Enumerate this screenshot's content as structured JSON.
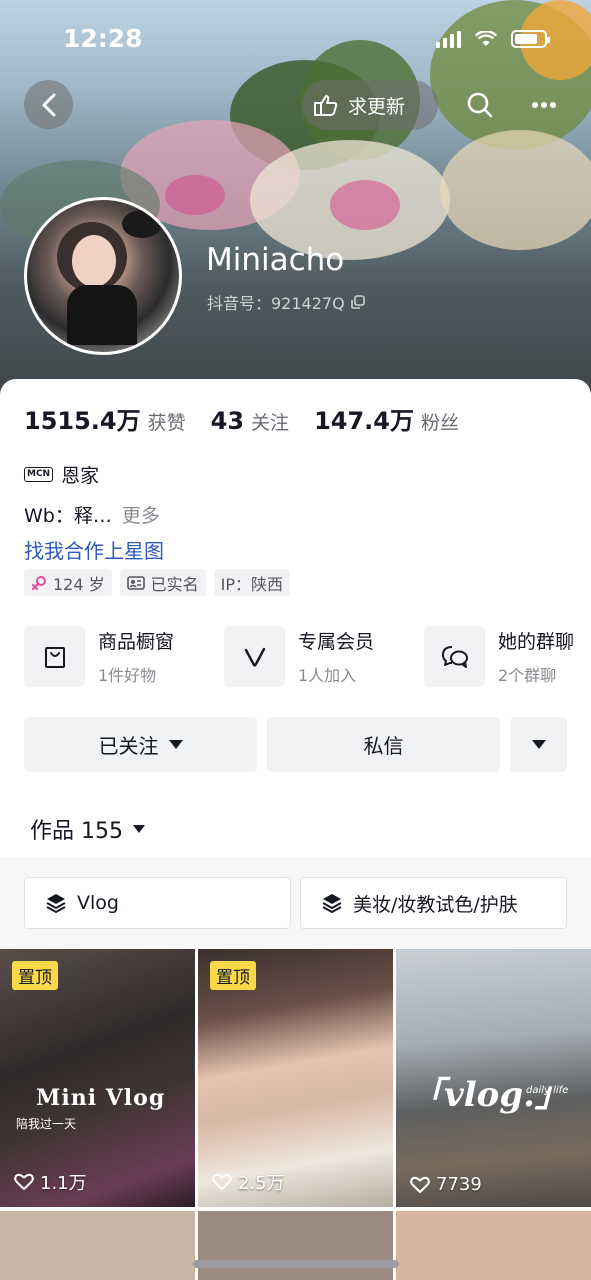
{
  "status_bar": {
    "time": "12:28"
  },
  "header": {
    "update_label": "求更新",
    "name": "Miniacho",
    "douyin_id": "抖音号：921427Q"
  },
  "stats": [
    {
      "value": "1515.4万",
      "label": "获赞"
    },
    {
      "value": "43",
      "label": "关注"
    },
    {
      "value": "147.4万",
      "label": "粉丝"
    }
  ],
  "mcn": {
    "badge": "MCN",
    "name": "恩家"
  },
  "bio": {
    "text": "Wb：释…",
    "more": "更多"
  },
  "star_link": "找我合作上星图",
  "tags": [
    {
      "icon": "female-icon",
      "text": "124 岁"
    },
    {
      "icon": "id-card-icon",
      "text": "已实名"
    },
    {
      "icon": "",
      "text": "IP：陕西"
    }
  ],
  "features": [
    {
      "icon": "shopping-bag-icon",
      "title": "商品橱窗",
      "sub": "1件好物"
    },
    {
      "icon": "member-v-icon",
      "title": "专属会员",
      "sub": "1人加入"
    },
    {
      "icon": "chat-bubbles-icon",
      "title": "她的群聊",
      "sub": "2个群聊"
    }
  ],
  "actions": {
    "followed": "已关注",
    "message": "私信"
  },
  "works": {
    "label": "作品 155"
  },
  "collections": [
    {
      "icon": "layers-icon",
      "label": "Vlog"
    },
    {
      "icon": "layers-icon",
      "label": "美妆/妆教试色/护肤"
    }
  ],
  "videos": [
    {
      "pinned": "置顶",
      "likes": "1.1万",
      "overlay_title": "Mini Vlog",
      "overlay_sub": "陪我过一天"
    },
    {
      "pinned": "置顶",
      "likes": "2.5万"
    },
    {
      "likes": "7739",
      "overlay_title": "「vlog.」",
      "overlay_sub": "daily life"
    }
  ],
  "colors": {
    "link": "#2f5bb8",
    "pin_badge": "#f9d94a",
    "female": "#e8489a"
  }
}
